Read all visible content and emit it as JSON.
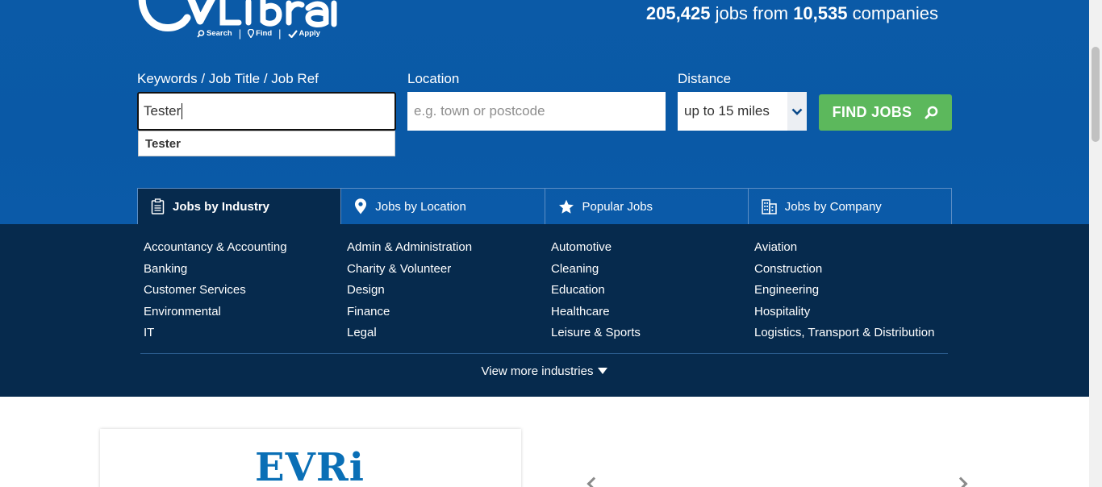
{
  "header": {
    "stats": {
      "jobs_count": "205,425",
      "jobs_text": "jobs from",
      "companies_count": "10,535",
      "companies_text": "companies"
    },
    "logo_tagline": {
      "search": "Search",
      "find": "Find",
      "apply": "Apply"
    }
  },
  "search": {
    "keywords_label": "Keywords / Job Title / Job Ref",
    "keywords_value": "Tester",
    "suggestion": "Tester",
    "location_label": "Location",
    "location_placeholder": "e.g. town or postcode",
    "distance_label": "Distance",
    "distance_value": "up to 15 miles",
    "find_button": "FIND JOBS"
  },
  "tabs": [
    {
      "label": "Jobs by Industry",
      "icon": "clipboard-icon",
      "active": true
    },
    {
      "label": "Jobs by Location",
      "icon": "map-pin-icon",
      "active": false
    },
    {
      "label": "Popular Jobs",
      "icon": "star-icon",
      "active": false
    },
    {
      "label": "Jobs by Company",
      "icon": "building-icon",
      "active": false
    }
  ],
  "industries": [
    "Accountancy & Accounting",
    "Admin & Administration",
    "Automotive",
    "Aviation",
    "Banking",
    "Charity & Volunteer",
    "Cleaning",
    "Construction",
    "Customer Services",
    "Design",
    "Education",
    "Engineering",
    "Environmental",
    "Finance",
    "Healthcare",
    "Hospitality",
    "IT",
    "Legal",
    "Leisure & Sports",
    "Logistics, Transport & Distribution"
  ],
  "view_more": "View more industries",
  "featured": {
    "brand": "EVRi"
  },
  "colors": {
    "hero_bg": "#0b5aa7",
    "industry_bg": "#062a4d",
    "find_button": "#5cb85c",
    "brand_blue": "#0a6fb6"
  }
}
